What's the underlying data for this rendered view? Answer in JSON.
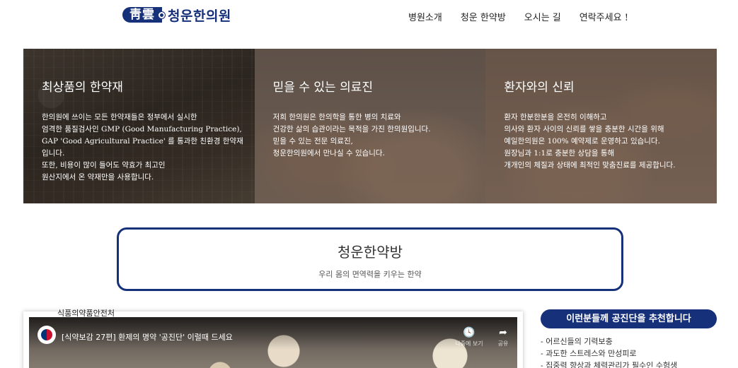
{
  "header": {
    "logo_hanja": "靑雲",
    "logo_text": "청운한의원",
    "nav": [
      "병원소개",
      "청운 한약방",
      "오시는 길",
      "연락주세요 !"
    ]
  },
  "hero": {
    "panels": [
      {
        "title": "최상품의 한약재",
        "lines": [
          "한의원에 쓰이는 모든 한약재들은 정부에서 실시한",
          "엄격한 품질검사인 GMP (Good Manufacturing Practice),",
          "GAP 'Good Agricultural Practice' 를 통과한 친환경 한약재",
          "입니다.",
          "또한, 비용이 많이 들어도 약효가 최고인",
          "원산지에서 온 약재만을 사용합니다."
        ]
      },
      {
        "title": "믿을 수 있는 의료진",
        "lines": [
          "저희 한의원은 한의학을 통한 병의 치료와",
          "건강한 삶의 습관이라는 목적을 가진 한의원입니다.",
          "믿을 수 있는 전문 의료진,",
          "청운한의원에서 만나실 수 있습니다."
        ]
      },
      {
        "title": "환자와의 신뢰",
        "lines": [
          "환자 한분한분을 온전히 이해하고",
          "의사와 환자 사이의 신뢰를 쌓을 충분한 시간을 위해",
          "예일한의원은 100% 예약제로 운영하고 있습니다.",
          "원장님과 1:1로 충분한 상담을 통해",
          "개개인의 체질과 상태에 최적인 맞춤진료를 제공합니다."
        ]
      }
    ]
  },
  "center": {
    "title": "청운한약방",
    "subtitle": "우리 몸의 면역력을 키우는 한약"
  },
  "video": {
    "channel": "식품의약품안전처",
    "title": "[식약보감 27편] 환제의 명약 '공진단' 이럴때 드세요",
    "actions": [
      {
        "icon": "clock-icon",
        "glyph": "🕓",
        "label": "나중에 보기"
      },
      {
        "icon": "share-icon",
        "glyph": "➦",
        "label": "공유"
      }
    ]
  },
  "recommend": {
    "title": "이런분들께 공진단을 추천합니다",
    "items": [
      "- 어르신들의 기력보충",
      "- 과도한 스트레스와 만성피로",
      "- 집중력 향상과 체력관리가 필수인 수험생"
    ]
  },
  "colors": {
    "brand": "#16307a"
  }
}
